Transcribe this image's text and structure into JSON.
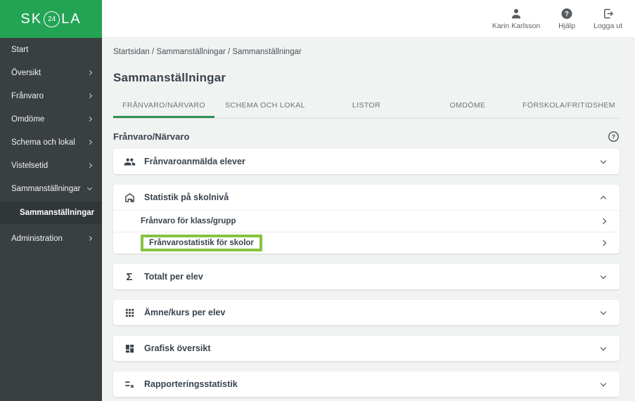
{
  "brand": {
    "logo_pre": "SK",
    "logo_circle": "24",
    "logo_post": "LA"
  },
  "header": {
    "user_name": "Karin Karlsson",
    "help_label": "Hjälp",
    "logout_label": "Logga ut"
  },
  "sidebar": {
    "items": [
      {
        "label": "Start",
        "chevron": "none"
      },
      {
        "label": "Översikt",
        "chevron": "right"
      },
      {
        "label": "Frånvaro",
        "chevron": "right"
      },
      {
        "label": "Omdöme",
        "chevron": "right"
      },
      {
        "label": "Schema och lokal",
        "chevron": "right"
      },
      {
        "label": "Vistelsetid",
        "chevron": "right"
      },
      {
        "label": "Sammanställningar",
        "chevron": "down",
        "expanded": true
      }
    ],
    "active_subitem": {
      "label": "Sammanställningar"
    },
    "bottom_items": [
      {
        "label": "Administration",
        "chevron": "right"
      }
    ]
  },
  "breadcrumb": "Startsidan / Sammanställningar / Sammanställningar",
  "page_title": "Sammanställningar",
  "tabs": [
    {
      "label": "FRÅNVARO/NÄRVARO",
      "active": true
    },
    {
      "label": "SCHEMA OCH LOKAL",
      "active": false
    },
    {
      "label": "LISTOR",
      "active": false
    },
    {
      "label": "OMDÖME",
      "active": false
    },
    {
      "label": "FÖRSKOLA/FRITIDSHEM",
      "active": false
    }
  ],
  "section": {
    "title": "Frånvaro/Närvaro"
  },
  "accordion_sections": [
    {
      "icon": "group-icon",
      "label": "Frånvaroanmälda elever",
      "state": "collapsed"
    },
    {
      "icon": "school-icon",
      "label": "Statistik på skolnivå",
      "state": "expanded",
      "children": [
        {
          "label": "Frånvaro för klass/grupp",
          "highlighted": false
        },
        {
          "label": "Frånvarostatistik för skolor",
          "highlighted": true
        }
      ]
    },
    {
      "icon": "sigma-icon",
      "label": "Totalt per elev",
      "state": "collapsed"
    },
    {
      "icon": "grid-icon",
      "label": "Ämne/kurs per elev",
      "state": "collapsed"
    },
    {
      "icon": "dashboard-icon",
      "label": "Grafisk översikt",
      "state": "collapsed"
    },
    {
      "icon": "report-icon",
      "label": "Rapporteringsstatistik",
      "state": "collapsed"
    }
  ],
  "icons": {
    "user-icon": "filled person silhouette",
    "help-icon": "question mark in filled circle",
    "logout-icon": "door frame with right arrow",
    "group-icon": "two people",
    "school-icon": "school building",
    "sigma-icon": "Σ",
    "grid-icon": "3x3 square dots",
    "dashboard-icon": "2x2 tiles",
    "report-icon": "list lines with x",
    "question-circle-icon": "question mark in outlined circle",
    "chevron-right-icon": "›",
    "chevron-down-icon": "⌄",
    "chevron-up-icon": "⌃"
  },
  "colors": {
    "brand_green": "#23a455",
    "highlight_green": "#85c340",
    "tab_underline_green": "#2f8f55",
    "sidebar_bg": "#3a4040",
    "sidebar_subnav_bg": "#313738",
    "content_bg": "#f1f2f2",
    "card_bg": "#ffffff",
    "dark_text": "#39434d",
    "muted_text": "#6e7478"
  }
}
